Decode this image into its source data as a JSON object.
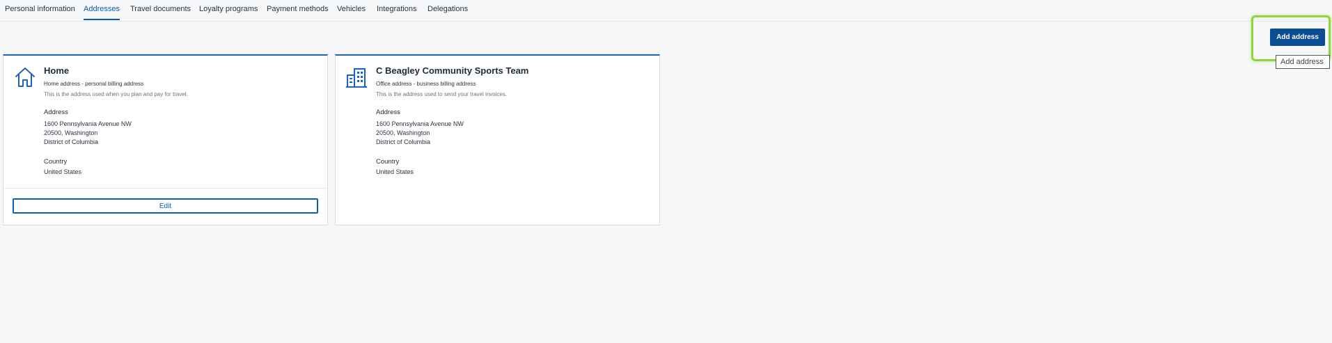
{
  "tabs": [
    {
      "label": "Personal information",
      "active": false
    },
    {
      "label": "Addresses",
      "active": true
    },
    {
      "label": "Travel documents",
      "active": false
    },
    {
      "label": "Loyalty programs",
      "active": false
    },
    {
      "label": "Payment methods",
      "active": false
    },
    {
      "label": "Vehicles",
      "active": false
    },
    {
      "label": "Integrations",
      "active": false
    },
    {
      "label": "Delegations",
      "active": false
    }
  ],
  "add_button": {
    "label": "Add address",
    "tooltip": "Add address"
  },
  "cards": {
    "home": {
      "icon": "home-icon",
      "title": "Home",
      "subtitle": "Home address - personal billing address",
      "description": "This is the address used when you plan and pay for travel.",
      "address_label": "Address",
      "address_lines": [
        "1600 Pennsylvania Avenue NW",
        "20500, Washington",
        "District of Columbia"
      ],
      "country_label": "Country",
      "country": "United States",
      "edit_label": "Edit"
    },
    "office": {
      "icon": "office-building-icon",
      "title": "C Beagley Community Sports Team",
      "subtitle": "Office address - business billing address",
      "description": "This is the address used to send your travel invoices.",
      "address_label": "Address",
      "address_lines": [
        "1600 Pennsylvania Avenue NW",
        "20500, Washington",
        "District of Columbia"
      ],
      "country_label": "Country",
      "country": "United States"
    }
  },
  "colors": {
    "accent": "#0b5cab",
    "primary_button": "#0b4e96",
    "highlight": "#8ed43a",
    "background": "#f6f7f9"
  }
}
